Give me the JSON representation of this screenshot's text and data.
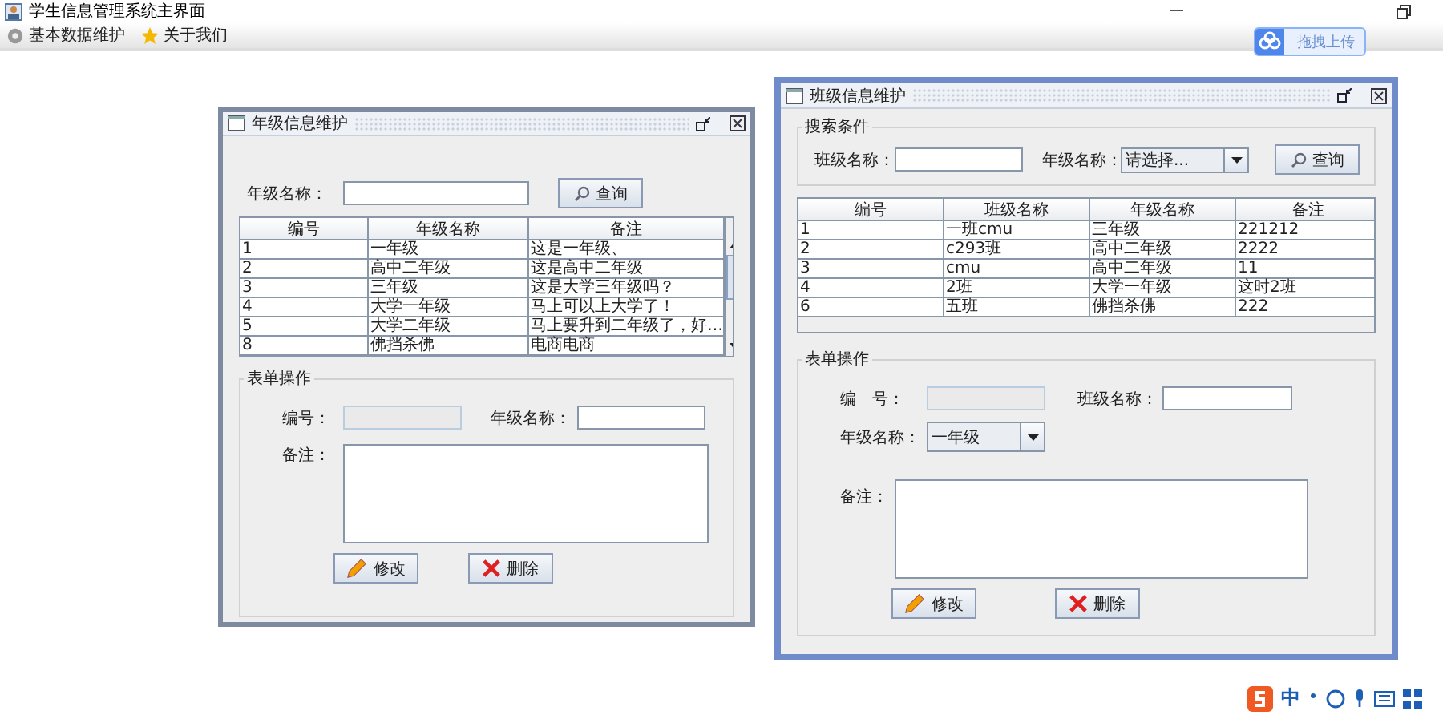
{
  "app": {
    "title": "学生信息管理系统主界面"
  },
  "menu": [
    {
      "label": "基本数据维护",
      "kind": "gear"
    },
    {
      "label": "关于我们",
      "kind": "star"
    }
  ],
  "upload_button": {
    "label": "拖拽上传"
  },
  "grade_window": {
    "title": "年级信息维护",
    "active": false,
    "search": {
      "label": "年级名称：",
      "button": "查询"
    },
    "table": {
      "columns": [
        "编号",
        "年级名称",
        "备注"
      ],
      "rows": [
        [
          "1",
          "一年级",
          "这是一年级、"
        ],
        [
          "2",
          "高中二年级",
          "这是高中二年级"
        ],
        [
          "3",
          "三年级",
          "这是大学三年级吗？"
        ],
        [
          "4",
          "大学一年级",
          "马上可以上大学了！"
        ],
        [
          "5",
          "大学二年级",
          "马上要升到二年级了，好…"
        ],
        [
          "8",
          "佛挡杀佛",
          "电商电商"
        ]
      ]
    },
    "form": {
      "legend": "表单操作",
      "id_label": "编号：",
      "name_label": "年级名称：",
      "note_label": "备注：",
      "buttons": [
        {
          "label": "修改",
          "kind": "edit"
        },
        {
          "label": "删除",
          "kind": "delete"
        }
      ]
    }
  },
  "class_window": {
    "title": "班级信息维护",
    "active": true,
    "search": {
      "legend": "搜索条件",
      "name_label": "班级名称：",
      "grade_label": "年级名称：",
      "grade_select": "请选择...",
      "button": "查询"
    },
    "table": {
      "columns": [
        "编号",
        "班级名称",
        "年级名称",
        "备注"
      ],
      "rows": [
        [
          "1",
          "一班cmu",
          "三年级",
          "221212"
        ],
        [
          "2",
          "c293班",
          "高中二年级",
          "2222"
        ],
        [
          "3",
          "cmu",
          "高中二年级",
          "11"
        ],
        [
          "4",
          "2班",
          "大学一年级",
          "这时2班"
        ],
        [
          "6",
          "五班",
          "佛挡杀佛",
          "222"
        ]
      ]
    },
    "form": {
      "legend": "表单操作",
      "id_label": "编　号：",
      "name_label": "班级名称：",
      "grade_label": "年级名称：",
      "grade_value": "一年级",
      "note_label": "备注：",
      "buttons": [
        {
          "label": "修改",
          "kind": "edit"
        },
        {
          "label": "删除",
          "kind": "delete"
        }
      ]
    }
  },
  "ime": {
    "label": "中"
  }
}
